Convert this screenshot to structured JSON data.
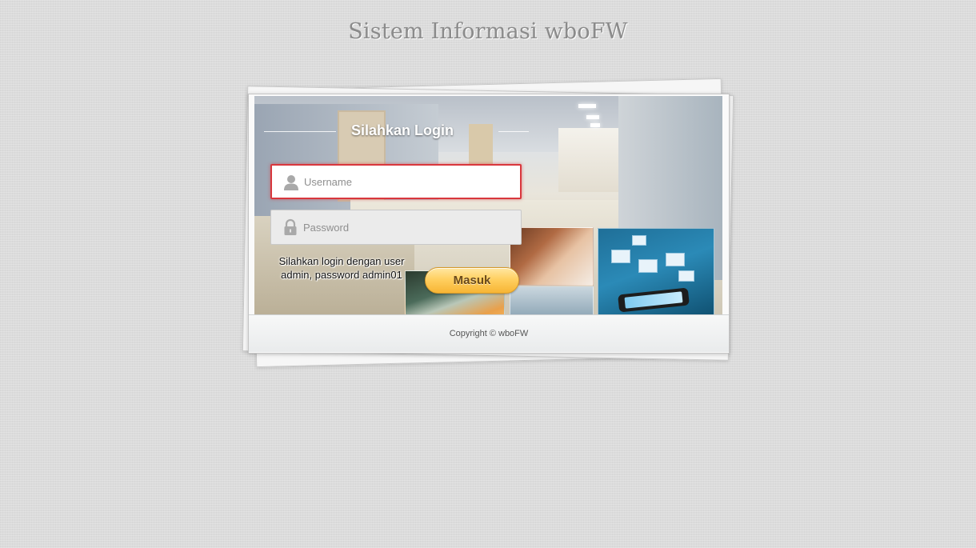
{
  "page": {
    "title": "Sistem Informasi wboFW"
  },
  "login": {
    "heading": "Silahkan Login",
    "username_placeholder": "Username",
    "password_placeholder": "Password",
    "hint": "Silahkan login dengan user admin, password admin01",
    "submit_label": "Masuk",
    "icons": {
      "username": "user-icon",
      "password": "lock-icon"
    },
    "accent_colors": {
      "error_border": "#d9373d",
      "button": "#ffd061"
    }
  },
  "footer": {
    "copyright": "Copyright © wboFW"
  }
}
